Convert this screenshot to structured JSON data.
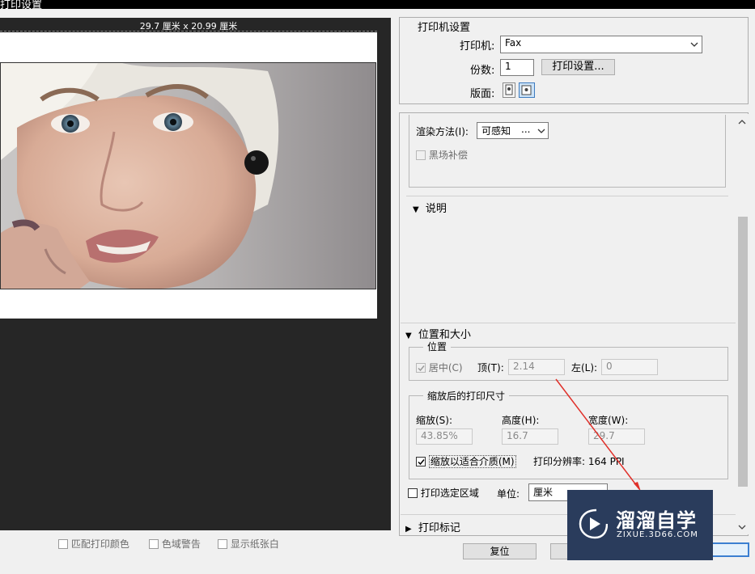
{
  "window": {
    "title": "打印设置"
  },
  "preview": {
    "paper_size": "29.7 厘米 x 20.99 厘米"
  },
  "preview_options": {
    "match_colors": "匹配打印颜色",
    "gamut_warning": "色域警告",
    "show_paper_white": "显示纸张白"
  },
  "printer": {
    "section_title": "打印机设置",
    "printer_label": "打印机:",
    "printer_value": "Fax",
    "copies_label": "份数:",
    "copies_value": "1",
    "print_settings_button": "打印设置...",
    "layout_label": "版面:"
  },
  "render": {
    "method_label": "渲染方法(I):",
    "method_value": "可感知",
    "method_ellipsis": "...",
    "black_point_label": "黑场补偿"
  },
  "description": {
    "title": "说明"
  },
  "position_size": {
    "title": "位置和大小",
    "position_legend": "位置",
    "center_label": "居中(C)",
    "top_label": "顶(T):",
    "top_value": "2.14",
    "left_label": "左(L):",
    "left_value": "0",
    "scaled_legend": "缩放后的打印尺寸",
    "scale_label": "缩放(S):",
    "scale_value": "43.85%",
    "height_label": "高度(H):",
    "height_value": "16.7",
    "width_label": "宽度(W):",
    "width_value": "29.7",
    "fit_media_label": "缩放以适合介质(M)",
    "print_resolution": "打印分辨率: 164 PPI",
    "print_selected_area": "打印选定区域",
    "unit_label": "单位:",
    "unit_value": "厘米"
  },
  "print_marks": {
    "title": "打印标记"
  },
  "buttons": {
    "reset": "复位"
  },
  "watermark": {
    "brand": "溜溜自学",
    "site": "ZIXUE.3D66.COM"
  },
  "colors": {
    "preview_bg": "#262626",
    "annotation_arrow": "#e0302a",
    "watermark_bg": "#2a3c5c"
  }
}
